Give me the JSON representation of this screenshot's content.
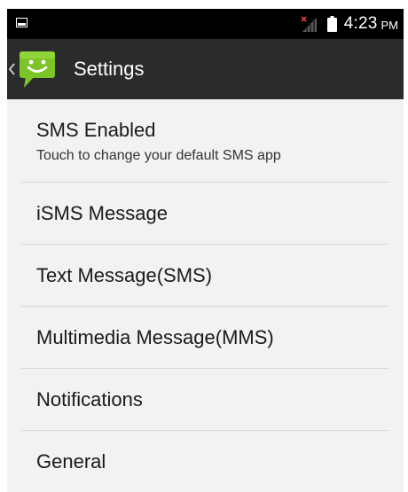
{
  "status_bar": {
    "time": "4:23",
    "ampm": "PM",
    "icons": [
      "screenshot-icon",
      "no-signal-icon",
      "battery-icon"
    ]
  },
  "action_bar": {
    "title": "Settings",
    "app_icon": "messaging-smiley-icon",
    "accent_color": "#7cc428"
  },
  "settings": {
    "items": [
      {
        "title": "SMS Enabled",
        "summary": "Touch to change your default SMS app"
      },
      {
        "title": "iSMS Message"
      },
      {
        "title": "Text Message(SMS)"
      },
      {
        "title": "Multimedia Message(MMS)"
      },
      {
        "title": "Notifications"
      },
      {
        "title": "General"
      }
    ]
  }
}
